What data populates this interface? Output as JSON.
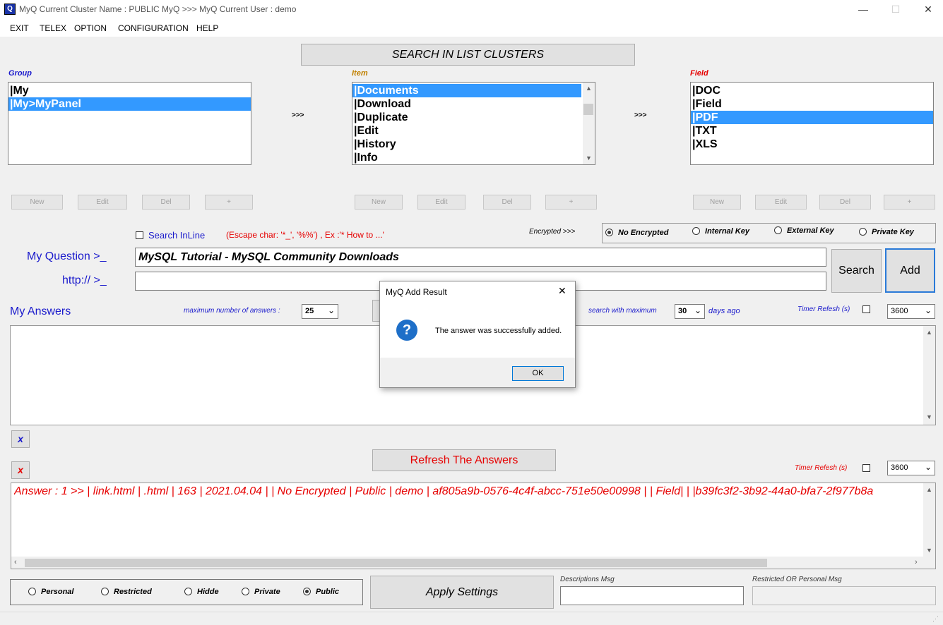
{
  "window": {
    "title": "MyQ Current Cluster Name : PUBLIC MyQ >>> MyQ Current User : demo",
    "icon": "Q",
    "min_glyph": "—",
    "max_glyph": "☐",
    "close_glyph": "✕"
  },
  "menu": [
    "EXIT",
    "TELEX",
    "OPTION",
    "CONFIGURATION",
    "HELP"
  ],
  "search_clusters_label": "SEARCH IN LIST CLUSTERS",
  "group": {
    "label": "Group",
    "items": [
      "|My",
      "|My>MyPanel"
    ],
    "buttons": [
      "New",
      "Edit",
      "Del",
      "+"
    ]
  },
  "item": {
    "label": "Item",
    "items": [
      "|Documents",
      "|Download",
      "|Duplicate",
      "|Edit",
      "|History",
      "|Info"
    ],
    "buttons": [
      "New",
      "Edit",
      "Del",
      "+"
    ]
  },
  "field": {
    "label": "Field",
    "items": [
      "|DOC",
      "|Field",
      "|PDF",
      "|TXT",
      "|XLS"
    ],
    "buttons": [
      "New",
      "Edit",
      "Del",
      "+"
    ]
  },
  "arrows": ">>>",
  "search_inline_label": "Search InLine",
  "escape_hint": "(Escape char: '*_', '%%') , Ex :'* How to ...'",
  "encrypted_label": "Encrypted >>>",
  "encryption": [
    "No Encrypted",
    "Internal Key",
    "External Key",
    "Private Key"
  ],
  "question_label": "My Question >_",
  "question_value": "MySQL Tutorial - MySQL Community Downloads",
  "http_label": "http:// >_",
  "http_value": "",
  "search_button": "Search",
  "add_button": "Add",
  "answers_label": "My Answers",
  "max_answers_label": "maximum number of answers :",
  "max_answers_value": "25",
  "search_with_max_label": "search with maximum",
  "days_value": "30",
  "days_ago_label": "days ago",
  "timer_label": "Timer Refesh (s)",
  "timer_value": "3600",
  "x_glyph": "x",
  "refresh_answers_button": "Refresh The Answers",
  "timer2_label": "Timer Refesh (s)",
  "timer2_value": "3600",
  "result_line": "Answer : 1 >> | link.html | .html | 163 | 2021.04.04 |  | No Encrypted | Public | demo | af805a9b-0576-4c4f-abcc-751e50e00998 |  | Field|   | |b39fc3f2-3b92-44a0-bfa7-2f977b8a",
  "visibility": [
    "Personal",
    "Restricted",
    "Hidde",
    "Private",
    "Public"
  ],
  "apply_settings_button": "Apply Settings",
  "descriptions_label": "Descriptions Msg",
  "restricted_label": "Restricted OR Personal Msg",
  "dialog": {
    "title": "MyQ Add Result",
    "message": "The answer was successfully added.",
    "ok": "OK",
    "icon_glyph": "?",
    "close_glyph": "✕"
  },
  "colors": {
    "selection": "#3399ff",
    "label_blue": "#1a1aff",
    "label_red": "#e60000",
    "label_gold": "#c08000",
    "dialog_icon": "#1e6fc8"
  }
}
